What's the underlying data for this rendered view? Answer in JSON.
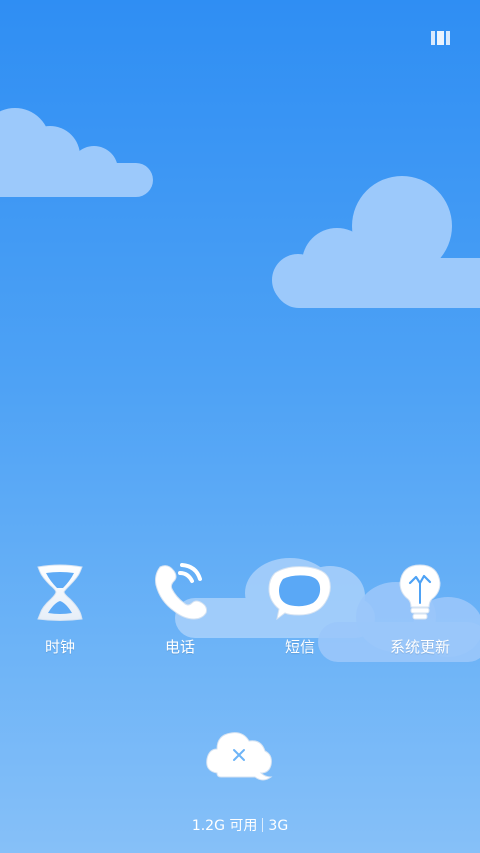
{
  "topbar": {
    "recents_icon": "recent-tasks-icon"
  },
  "apps": [
    {
      "id": "clock",
      "label": "时钟",
      "icon": "hourglass-icon"
    },
    {
      "id": "phone",
      "label": "电话",
      "icon": "phone-icon"
    },
    {
      "id": "sms",
      "label": "短信",
      "icon": "message-bubble-icon"
    },
    {
      "id": "update",
      "label": "系统更新",
      "icon": "lightbulb-icon"
    }
  ],
  "clean_button": {
    "icon": "cloud-close-icon"
  },
  "memory": {
    "available": "1.2G 可用",
    "network": "3G"
  },
  "colors": {
    "sky_top": "#2f8ef3",
    "sky_bottom": "#86c0f8",
    "cloud": "#9cc9fb",
    "icon_white": "#ffffff"
  }
}
